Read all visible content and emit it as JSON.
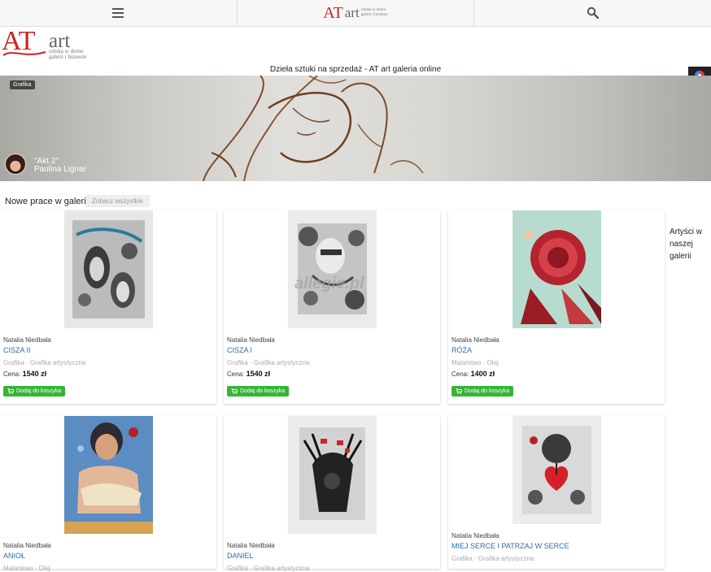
{
  "nav": {
    "menu_icon": "hamburger-icon",
    "search_icon": "search-icon"
  },
  "logo": {
    "initials": "AT",
    "word": "art",
    "tagline_1": "sztuka w domu",
    "tagline_2": "galerii i biznesie"
  },
  "site_title": "Dzieła sztuki na sprzedaż - AT art galeria online",
  "hero": {
    "category": "Grafika",
    "work_title": "\"Akt 2\"",
    "artist": "Paulina Lignar"
  },
  "section": {
    "title": "Nowe prace w galerii",
    "see_all": "Zobacz wszystkie"
  },
  "products": [
    {
      "artist": "Natalia Niedbała",
      "title": "CISZA II",
      "category": "Grafika · Grafika artystyczna",
      "price_label": "Cena:",
      "price": "1540 zł",
      "cart": "Dodaj do koszyka"
    },
    {
      "artist": "Natalia Niedbała",
      "title": "CISZA I",
      "category": "Grafika · Grafika artystyczna",
      "price_label": "Cena:",
      "price": "1540 zł",
      "cart": "Dodaj do koszyka"
    },
    {
      "artist": "Natalia Niedbała",
      "title": "RÓŻA",
      "category": "Malarstwo · Olej",
      "price_label": "Cena:",
      "price": "1400 zł",
      "cart": "Dodaj do koszyka"
    },
    {
      "artist": "Natalia Niedbała",
      "title": "ANIOŁ",
      "category": "Malarstwo · Olej"
    },
    {
      "artist": "Natalia Niedbała",
      "title": "DANIEL",
      "category": "Grafika · Grafika artystyczna"
    },
    {
      "artist": "Natalia Niedbała",
      "title": "MIEJ SERCE I PATRZAJ W SERCE",
      "category": "Grafika · Grafika artystyczna"
    }
  ],
  "sidebar": {
    "artists_heading": "Artyści w naszej galerii"
  },
  "watermark": "allegie.pl",
  "colors": {
    "accent": "#c22222",
    "link": "#2a6db0",
    "cart": "#35b535"
  }
}
